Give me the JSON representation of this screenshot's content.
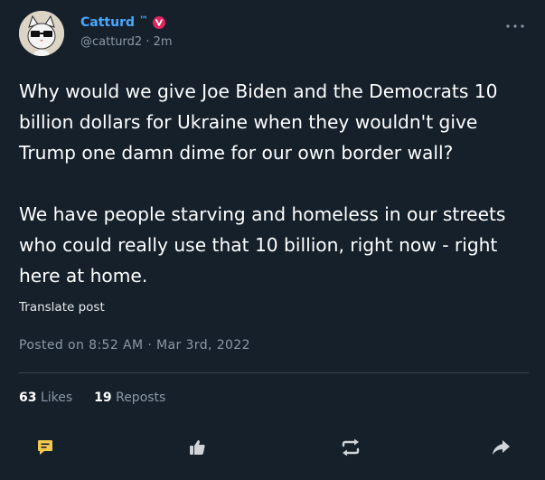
{
  "author": {
    "display_name": "Catturd",
    "tm": "™",
    "badge_letter": "v",
    "handle": "@catturd2",
    "separator": "·",
    "time_ago": "2m"
  },
  "post": {
    "text": "Why would we give Joe Biden and the Democrats 10 billion dollars for Ukraine when they wouldn't give Trump one damn dime for our own border wall?\n\nWe have people starving and homeless in our streets who could really use that 10 billion, right now - right here at home.",
    "translate_label": "Translate post",
    "timestamp": "Posted on 8:52 AM · Mar 3rd, 2022"
  },
  "stats": {
    "likes_count": "63",
    "likes_label": "Likes",
    "reposts_count": "19",
    "reposts_label": "Reposts"
  },
  "actions": [
    {
      "icon": "comment-icon"
    },
    {
      "icon": "like-icon"
    },
    {
      "icon": "repost-icon"
    },
    {
      "icon": "share-icon"
    }
  ],
  "colors": {
    "background": "#15202b",
    "accent": "#4aa8ff",
    "badge": "#e0245e",
    "muted": "#8b98a5"
  }
}
